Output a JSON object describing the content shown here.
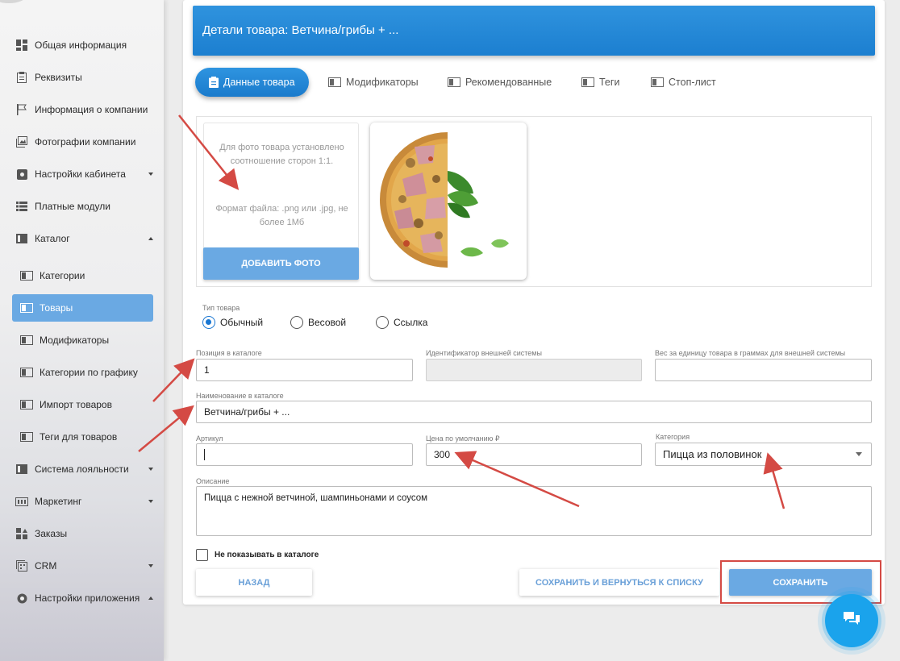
{
  "sidebar": {
    "items": [
      {
        "label": "Общая информация",
        "icon": "dashboard-icon"
      },
      {
        "label": "Реквизиты",
        "icon": "clipboard-icon"
      },
      {
        "label": "Информация о компании",
        "icon": "flag-icon"
      },
      {
        "label": "Фотографии компании",
        "icon": "photo-icon"
      },
      {
        "label": "Настройки кабинета",
        "icon": "gear-icon"
      },
      {
        "label": "Платные модули",
        "icon": "list-icon"
      },
      {
        "label": "Каталог",
        "icon": "catalog-icon"
      },
      {
        "label": "Категории",
        "icon": "tile-icon"
      },
      {
        "label": "Товары",
        "icon": "tile-icon"
      },
      {
        "label": "Модификаторы",
        "icon": "tile-icon"
      },
      {
        "label": "Категории по графику",
        "icon": "tile-icon"
      },
      {
        "label": "Импорт товаров",
        "icon": "tile-icon"
      },
      {
        "label": "Теги для товаров",
        "icon": "tile-icon"
      },
      {
        "label": "Система лояльности",
        "icon": "catalog-icon"
      },
      {
        "label": "Маркетинг",
        "icon": "marketing-icon"
      },
      {
        "label": "Заказы",
        "icon": "orders-icon"
      },
      {
        "label": "CRM",
        "icon": "crm-icon"
      },
      {
        "label": "Настройки приложения",
        "icon": "gear-icon"
      }
    ]
  },
  "header": {
    "title": "Детали товара: Ветчина/грибы + ..."
  },
  "tabs": [
    {
      "label": "Данные товара"
    },
    {
      "label": "Модификаторы"
    },
    {
      "label": "Рекомендованные"
    },
    {
      "label": "Теги"
    },
    {
      "label": "Стоп-лист"
    }
  ],
  "photo": {
    "hint1": "Для фото товара установлено соотношение сторон 1:1.",
    "hint2": "Формат файла: .png или .jpg, не более 1Мб",
    "add_button": "ДОБАВИТЬ ФОТО"
  },
  "form": {
    "type_label": "Тип товара",
    "type_options": [
      "Обычный",
      "Весовой",
      "Ссылка"
    ],
    "type_selected": "Обычный",
    "position_label": "Позиция в каталоге",
    "position_value": "1",
    "external_id_label": "Идентификатор внешней системы",
    "external_id_value": "",
    "weight_label": "Вес за единицу товара в граммах для внешней системы",
    "weight_value": "",
    "name_label": "Наименование в каталоге",
    "name_value": "Ветчина/грибы + ...",
    "sku_label": "Артикул",
    "sku_value": "",
    "price_label": "Цена по умолчанию ₽",
    "price_value": "300",
    "category_label": "Категория",
    "category_value": "Пицца из половинок",
    "description_label": "Описание",
    "description_value": "Пицца с нежной ветчиной, шампиньонами и соусом",
    "hide_label": "Не показывать в каталоге"
  },
  "buttons": {
    "back": "НАЗАД",
    "save_return": "СОХРАНИТЬ И ВЕРНУТЬСЯ К СПИСКУ",
    "save": "СОХРАНИТЬ"
  },
  "colors": {
    "accent": "#1c7fd0",
    "button": "#6aa9e3",
    "annotation": "#d44a44"
  }
}
